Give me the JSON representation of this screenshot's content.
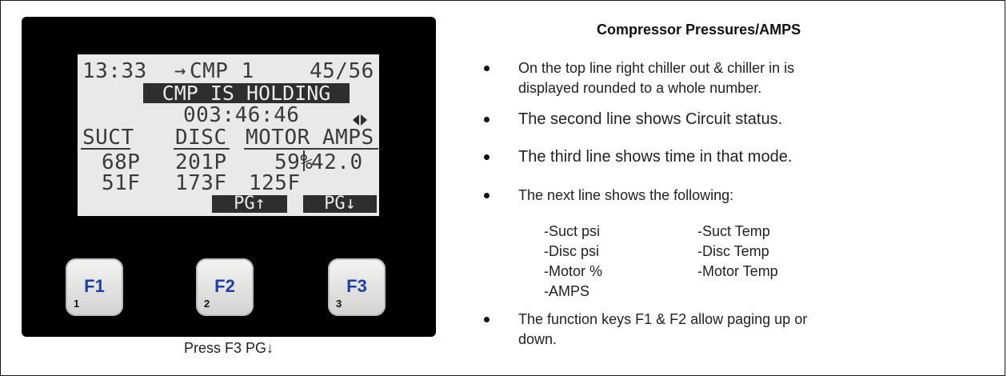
{
  "lcd": {
    "line1": {
      "time": "13:33",
      "circuit": "CMP 1",
      "temps": "45/56"
    },
    "status": "CMP IS HOLDING",
    "duration": "003:46:46",
    "headers": {
      "suct": "SUCT",
      "disc": "DISC",
      "motor": "MOTOR",
      "amps": "AMPS"
    },
    "row1": {
      "suct": "68P",
      "disc": "201P",
      "motor": "59%",
      "amps": "42.0"
    },
    "row2": {
      "suct": "51F",
      "disc": "173F",
      "motor": "125F"
    },
    "softkeys": {
      "up": "PG↑",
      "down": "PG↓"
    }
  },
  "keys": [
    {
      "label": "F1",
      "num": "1"
    },
    {
      "label": "F2",
      "num": "2"
    },
    {
      "label": "F3",
      "num": "3"
    }
  ],
  "caption": "Press F3 PG↓",
  "description": {
    "title": "Compressor Pressures/AMPS",
    "bullets": [
      {
        "lines": [
          "On the top line right chiller out & chiller in is",
          "displayed rounded to a whole number."
        ]
      },
      {
        "lines": [
          "The second line shows Circuit status."
        ]
      },
      {
        "lines": [
          "The third line shows time in that mode."
        ]
      },
      {
        "lines": [
          "The next line shows the following:"
        ]
      },
      {
        "lines": [
          "The function keys F1 & F2 allow paging up or",
          "down."
        ]
      }
    ],
    "sublist": {
      "left": [
        "-Suct psi",
        "-Disc psi",
        "-Motor %",
        "-AMPS"
      ],
      "right": [
        "-Suct Temp",
        "-Disc Temp",
        "-Motor Temp"
      ]
    }
  }
}
